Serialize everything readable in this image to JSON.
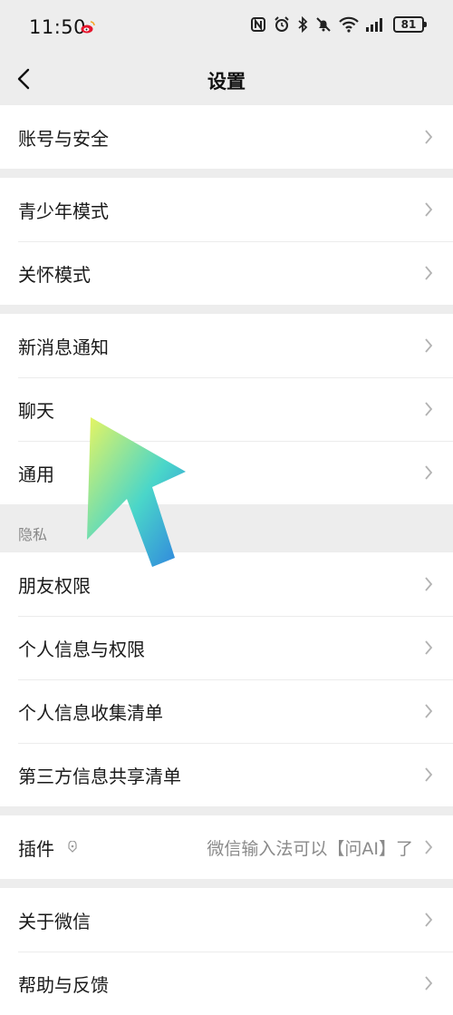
{
  "status": {
    "time": "11:50",
    "battery": "81",
    "icons": [
      "weibo-icon",
      "nfc-icon",
      "alarm-icon",
      "bluetooth-icon",
      "mute-icon",
      "wifi-icon",
      "signal-icon",
      "battery-icon"
    ]
  },
  "nav": {
    "title": "设置",
    "back_icon": "back-arrow-icon"
  },
  "groups": {
    "account": {
      "items": [
        "账号与安全"
      ]
    },
    "modes": {
      "items": [
        "青少年模式",
        "关怀模式"
      ]
    },
    "messaging": {
      "items": [
        "新消息通知",
        "聊天",
        "通用"
      ]
    },
    "privacy": {
      "label": "隐私",
      "items": [
        "朋友权限",
        "个人信息与权限",
        "个人信息收集清单",
        "第三方信息共享清单"
      ]
    },
    "plugins": {
      "label": "插件",
      "value": "微信输入法可以【问AI】了"
    },
    "about": {
      "items": [
        "关于微信",
        "帮助与反馈"
      ]
    }
  },
  "colors": {
    "background": "#ededed",
    "card": "#ffffff",
    "divider": "#ececec",
    "arrow_gradient_start": "#e8f560",
    "arrow_gradient_mid": "#4ad6c9",
    "arrow_gradient_end": "#2e7fe0"
  }
}
